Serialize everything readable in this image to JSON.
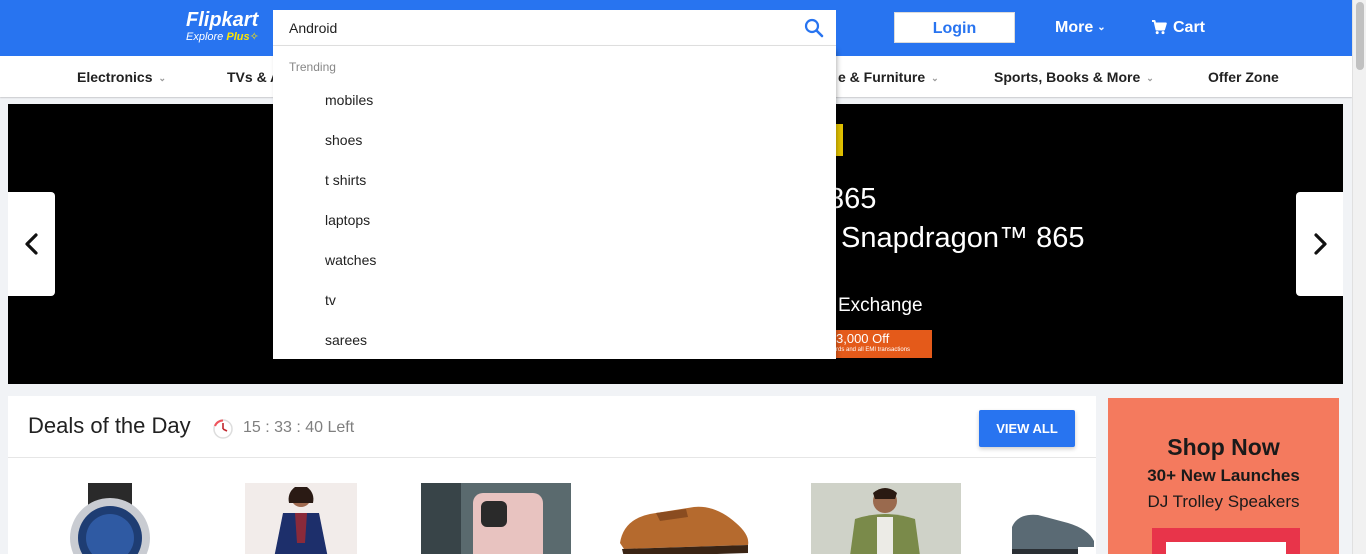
{
  "header": {
    "logo_text": "Flipkart",
    "logo_sub_explore": "Explore",
    "logo_sub_plus": "Plus",
    "search_value": "Android",
    "login_label": "Login",
    "more_label": "More",
    "cart_label": "Cart",
    "brand_color": "#2874f0",
    "accent_yellow": "#ffe500"
  },
  "categories": [
    {
      "label": "Electronics"
    },
    {
      "label": "TVs & A"
    },
    {
      "label": "e & Furniture"
    },
    {
      "label": "Sports, Books & More"
    },
    {
      "label": "Offer Zone"
    }
  ],
  "banner": {
    "line1": "865",
    "line2": "Snapdragon™ 865",
    "line3": "Exchange",
    "offer_main": "3,000 Off",
    "offer_small": "rds and all EMI transactions"
  },
  "dropdown": {
    "heading": "Trending",
    "items": [
      {
        "label": "mobiles"
      },
      {
        "label": "shoes"
      },
      {
        "label": "t shirts"
      },
      {
        "label": "laptops"
      },
      {
        "label": "watches"
      },
      {
        "label": "tv"
      },
      {
        "label": "sarees"
      }
    ]
  },
  "deals": {
    "title": "Deals of the Day",
    "timer": "15 : 33 : 40 Left",
    "view_all": "VIEW ALL"
  },
  "ad": {
    "title": "Shop Now",
    "subtitle": "30+ New Launches",
    "product": "DJ Trolley Speakers"
  },
  "icons": {
    "search": "search-icon",
    "cart": "cart-icon",
    "chevron": "chevron-down-icon",
    "clock": "clock-icon",
    "arrow_left": "chevron-left-icon",
    "arrow_right": "chevron-right-icon"
  }
}
